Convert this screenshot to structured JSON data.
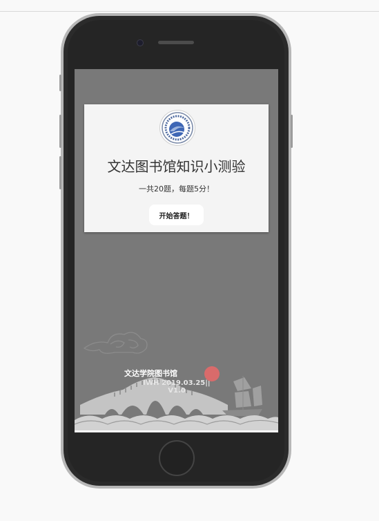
{
  "quiz": {
    "title": "文达图书馆知识小测验",
    "subtitle": "一共20题，每题5分！",
    "start_label": "开始答题！"
  },
  "footer": {
    "line1": "文达学院图书馆",
    "line2": "IWH 2019.03.25|| V1.0"
  },
  "colors": {
    "screen_bg": "#797979",
    "card_bg": "#f4f4f4",
    "phone_frame": "#b7b7b7",
    "accent_dot": "#d96b6b"
  },
  "icons": [
    "library-logo-icon",
    "cloud-icon",
    "bridge-icon",
    "sailboat-icon",
    "waves-icon"
  ]
}
